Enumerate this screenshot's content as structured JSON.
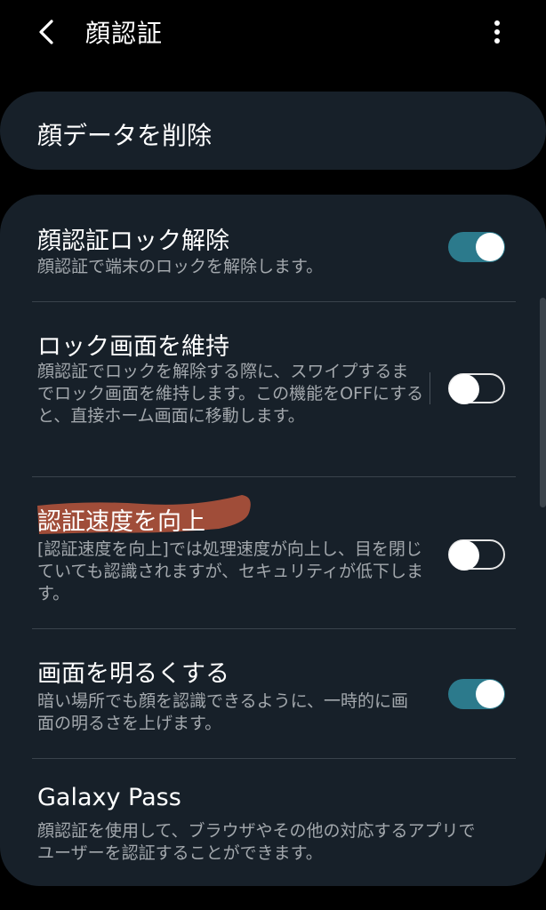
{
  "header": {
    "title": "顔認証"
  },
  "delete_face_data": {
    "label": "顔データを削除"
  },
  "settings": {
    "face_unlock": {
      "title": "顔認証ロック解除",
      "description": "顔認証で端末のロックを解除します。",
      "enabled": true
    },
    "stay_on_lock_screen": {
      "title": "ロック画面を維持",
      "description": "顔認証でロックを解除する際に、スワイプするまでロック画面を維持します。この機能をOFFにすると、直接ホーム画面に移動します。",
      "enabled": false
    },
    "faster_recognition": {
      "title": "認証速度を向上",
      "description": "[認証速度を向上]では処理速度が向上し、目を閉じていても認識されますが、セキュリティが低下します。",
      "enabled": false
    },
    "brighten_screen": {
      "title": "画面を明るくする",
      "description": "暗い場所でも顔を認識できるように、一時的に画面の明るさを上げます。",
      "enabled": true
    },
    "galaxy_pass": {
      "title": "Galaxy Pass",
      "description": "顔認証を使用して、ブラウザやその他の対応するアプリでユーザーを認証することができます。"
    }
  },
  "colors": {
    "background": "#000000",
    "card": "#172029",
    "toggle_on": "#2c7a8c",
    "highlight_mark": "#c65a3e"
  }
}
